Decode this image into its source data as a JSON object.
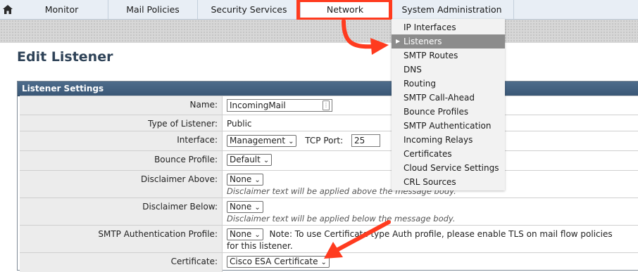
{
  "nav": {
    "home_icon": "home-icon",
    "tabs": [
      "Monitor",
      "Mail Policies",
      "Security Services",
      "Network",
      "System Administration"
    ]
  },
  "page_title": "Edit Listener",
  "panel": {
    "header": "Listener Settings",
    "name_label": "Name:",
    "name_value": "IncomingMail",
    "type_label": "Type of Listener:",
    "type_value": "Public",
    "interface_label": "Interface:",
    "interface_value": "Management",
    "tcp_port_label": "TCP Port:",
    "tcp_port_value": "25",
    "bounce_label": "Bounce Profile:",
    "bounce_value": "Default",
    "disc_above_label": "Disclaimer Above:",
    "disc_above_value": "None",
    "disc_above_hint": "Disclaimer text will be applied above the message body.",
    "disc_below_label": "Disclaimer Below:",
    "disc_below_value": "None",
    "disc_below_hint": "Disclaimer text will be applied below the message body.",
    "smtp_auth_label": "SMTP Authentication Profile:",
    "smtp_auth_value": "None",
    "smtp_auth_note": "Note: To use Certificate type Auth profile, please enable TLS on mail flow policies for this listener.",
    "cert_label": "Certificate:",
    "cert_value": "Cisco ESA Certificate"
  },
  "network_menu": {
    "items": [
      "IP Interfaces",
      "Listeners",
      "SMTP Routes",
      "DNS",
      "Routing",
      "SMTP Call-Ahead",
      "Bounce Profiles",
      "SMTP Authentication",
      "Incoming Relays",
      "Certificates",
      "Cloud Service Settings",
      "CRL Sources"
    ],
    "active": "Listeners"
  },
  "colors": {
    "accent_highlight": "#ff3b1f",
    "panel_header": "#3f5c7a",
    "title": "#2f4358"
  }
}
